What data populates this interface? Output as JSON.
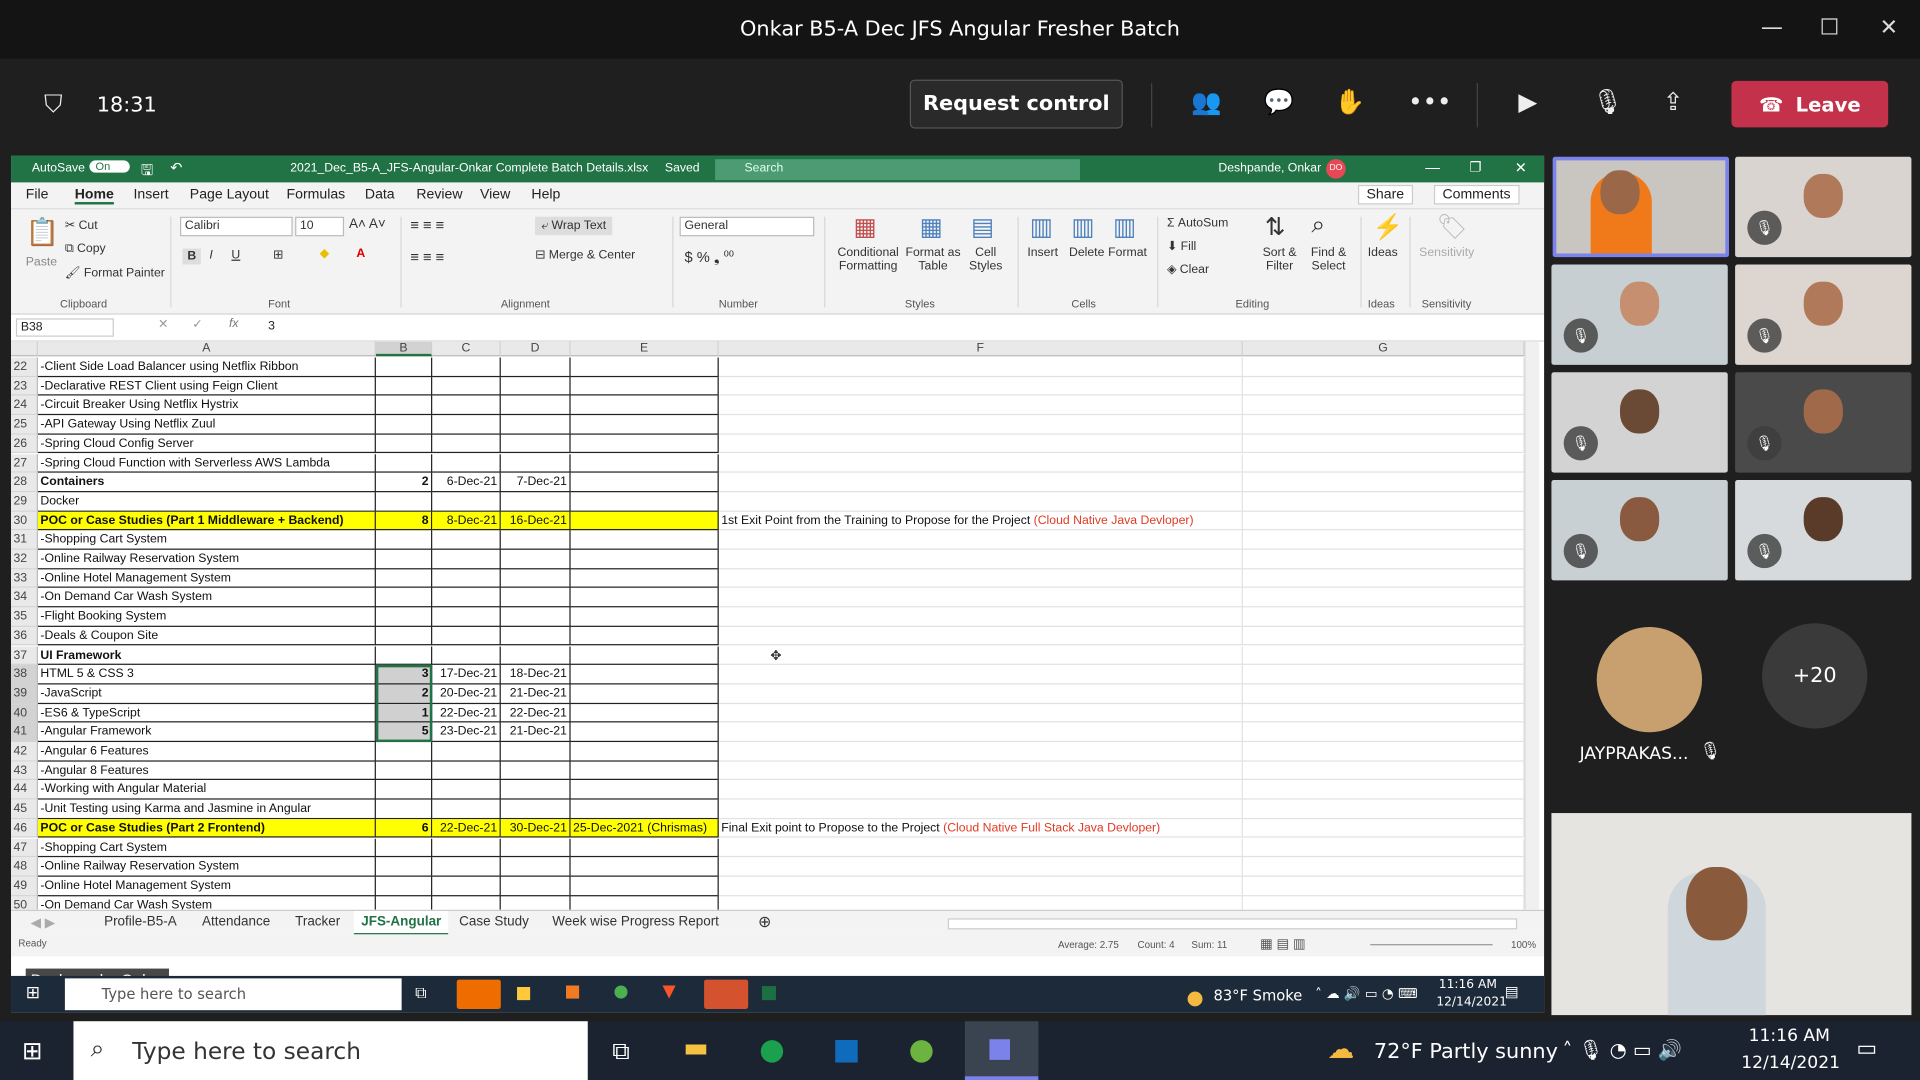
{
  "window": {
    "title": "Onkar B5-A Dec JFS Angular Fresher Batch"
  },
  "meeting": {
    "time": "18:31",
    "request_control": "Request control",
    "leave": "Leave"
  },
  "excel": {
    "autosave": "AutoSave",
    "autosave_state": "On",
    "file_title": "2021_Dec_B5-A_JFS-Angular-Onkar Complete Batch Details.xlsx",
    "saved": "Saved",
    "search": "Search",
    "user": "Deshpande, Onkar",
    "user_initials": "DO",
    "menu": [
      "File",
      "Home",
      "Insert",
      "Page Layout",
      "Formulas",
      "Data",
      "Review",
      "View",
      "Help"
    ],
    "share": "Share",
    "comments": "Comments",
    "ribbon": {
      "clipboard": {
        "paste": "Paste",
        "cut": "Cut",
        "copy": "Copy",
        "format_painter": "Format Painter",
        "label": "Clipboard"
      },
      "font": {
        "name": "Calibri",
        "size": "10",
        "label": "Font"
      },
      "alignment": {
        "wrap": "Wrap Text",
        "merge": "Merge & Center",
        "label": "Alignment"
      },
      "number": {
        "format": "General",
        "label": "Number"
      },
      "styles": {
        "cond": "Conditional Formatting",
        "table": "Format as Table",
        "cell": "Cell Styles",
        "label": "Styles"
      },
      "cells": {
        "insert": "Insert",
        "delete": "Delete",
        "format": "Format",
        "label": "Cells"
      },
      "editing": {
        "autosum": "AutoSum",
        "fill": "Fill",
        "clear": "Clear",
        "sort": "Sort & Filter",
        "find": "Find & Select",
        "label": "Editing"
      },
      "ideas": {
        "ideas": "Ideas",
        "label": "Ideas"
      },
      "sensitivity": {
        "sens": "Sensitivity",
        "label": "Sensitivity"
      }
    },
    "namebox": "B38",
    "formula": "3",
    "columns": [
      "A",
      "B",
      "C",
      "D",
      "E",
      "F",
      "G"
    ],
    "rows": [
      {
        "n": "22",
        "a": "-Client Side Load Balancer using Netflix Ribbon"
      },
      {
        "n": "23",
        "a": "-Declarative REST Client using Feign Client"
      },
      {
        "n": "24",
        "a": "-Circuit Breaker Using Netflix Hystrix"
      },
      {
        "n": "25",
        "a": "-API Gateway Using Netflix Zuul"
      },
      {
        "n": "26",
        "a": "-Spring Cloud Config Server"
      },
      {
        "n": "27",
        "a": "-Spring Cloud Function with Serverless AWS Lambda"
      },
      {
        "n": "28",
        "a": "Containers",
        "b": "2",
        "c": "6-Dec-21",
        "d": "7-Dec-21",
        "bold": true
      },
      {
        "n": "29",
        "a": "Docker"
      },
      {
        "n": "30",
        "a": "POC or Case Studies (Part 1 Middleware + Backend)",
        "b": "8",
        "c": "8-Dec-21",
        "d": "16-Dec-21",
        "f": "1st Exit Point from the Training to Propose for the Project ",
        "f2": "(Cloud Native Java Devloper)",
        "bold": true,
        "yellow": true
      },
      {
        "n": "31",
        "a": "-Shopping Cart System"
      },
      {
        "n": "32",
        "a": "-Online Railway Reservation System"
      },
      {
        "n": "33",
        "a": "-Online Hotel Management System"
      },
      {
        "n": "34",
        "a": "-On Demand Car Wash System"
      },
      {
        "n": "35",
        "a": "-Flight Booking System"
      },
      {
        "n": "36",
        "a": "-Deals & Coupon Site"
      },
      {
        "n": "37",
        "a": "UI Framework",
        "bold": true
      },
      {
        "n": "38",
        "a": "HTML 5 & CSS 3",
        "b": "3",
        "c": "17-Dec-21",
        "d": "18-Dec-21",
        "sel": true
      },
      {
        "n": "39",
        "a": "-JavaScript",
        "b": "2",
        "c": "20-Dec-21",
        "d": "21-Dec-21",
        "sel": true
      },
      {
        "n": "40",
        "a": "-ES6 & TypeScript",
        "b": "1",
        "c": "22-Dec-21",
        "d": "22-Dec-21",
        "sel": true
      },
      {
        "n": "41",
        "a": "-Angular Framework",
        "b": "5",
        "c": "23-Dec-21",
        "d": "21-Dec-21",
        "sel": true
      },
      {
        "n": "42",
        "a": "-Angular 6 Features"
      },
      {
        "n": "43",
        "a": "-Angular 8 Features"
      },
      {
        "n": "44",
        "a": "-Working with Angular Material"
      },
      {
        "n": "45",
        "a": "-Unit Testing using Karma and Jasmine in Angular"
      },
      {
        "n": "46",
        "a": "POC or Case Studies (Part 2 Frontend)",
        "b": "6",
        "c": "22-Dec-21",
        "d": "30-Dec-21",
        "e": "25-Dec-2021 (Chrismas)",
        "f": "Final Exit point to Propose to the Project ",
        "f2": "(Cloud Native Full Stack Java Devloper)",
        "bold": true,
        "yellow": true
      },
      {
        "n": "47",
        "a": "-Shopping Cart System"
      },
      {
        "n": "48",
        "a": "-Online Railway Reservation System"
      },
      {
        "n": "49",
        "a": "-Online Hotel Management System"
      },
      {
        "n": "50",
        "a": "-On Demand Car Wash System"
      }
    ],
    "sheet_tabs": [
      "Profile-B5-A",
      "Attendance",
      "Tracker",
      "JFS-Angular",
      "Case Study",
      "Week wise Progress Report"
    ],
    "active_tab": "JFS-Angular",
    "status": {
      "ready": "Ready",
      "average": "Average: 2.75",
      "count": "Count: 4",
      "sum": "Sum: 11",
      "zoom": "100%"
    },
    "presenter": "Deshpande, Onkar"
  },
  "inner_taskbar": {
    "search": "Type here to search",
    "weather": "83°F Smoke",
    "time": "11:16 AM",
    "date": "12/14/2021"
  },
  "participants": {
    "named": "JAYPRAKAS...",
    "more": "+20"
  },
  "taskbar": {
    "search": "Type here to search",
    "weather": "72°F Partly sunny",
    "time": "11:16 AM",
    "date": "12/14/2021"
  },
  "colors": {
    "teams_leave": "#c4314b",
    "excel_green": "#217346",
    "highlight": "#ffff00"
  }
}
